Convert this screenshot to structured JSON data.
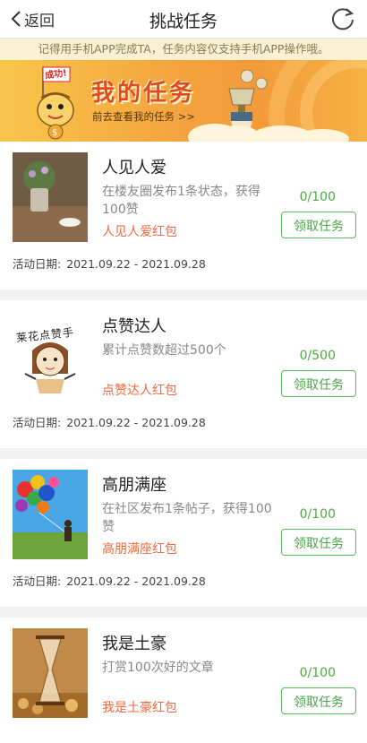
{
  "header": {
    "back_label": "返回",
    "title": "挑战任务",
    "refresh_icon": "refresh-icon"
  },
  "notice": "记得用手机APP完成TA，任务内容仅支持手机APP操作哦。",
  "banner": {
    "badge": "成功!",
    "title": "我的任务",
    "subtitle": "前去查看我的任务 >>"
  },
  "date_label": "活动日期:",
  "tasks": [
    {
      "name": "人见人爱",
      "desc": "在楼友圈发布1条状态，获得100赞",
      "reward": "人见人爱红包",
      "progress": "0/100",
      "button": "领取任务",
      "dates": "2021.09.22 - 2021.09.28"
    },
    {
      "name": "点赞达人",
      "desc": "累计点赞数超过500个",
      "reward": "点赞达人红包",
      "progress": "0/500",
      "button": "领取任务",
      "dates": "2021.09.22 - 2021.09.28",
      "image_caption": "莱花点赞手"
    },
    {
      "name": "高朋满座",
      "desc": "在社区发布1条帖子，获得100赞",
      "reward": "高朋满座红包",
      "progress": "0/100",
      "button": "领取任务",
      "dates": "2021.09.22 - 2021.09.28"
    },
    {
      "name": "我是土豪",
      "desc": "打赏100次好的文章",
      "reward": "我是土豪红包",
      "progress": "0/100",
      "button": "领取任务"
    }
  ]
}
